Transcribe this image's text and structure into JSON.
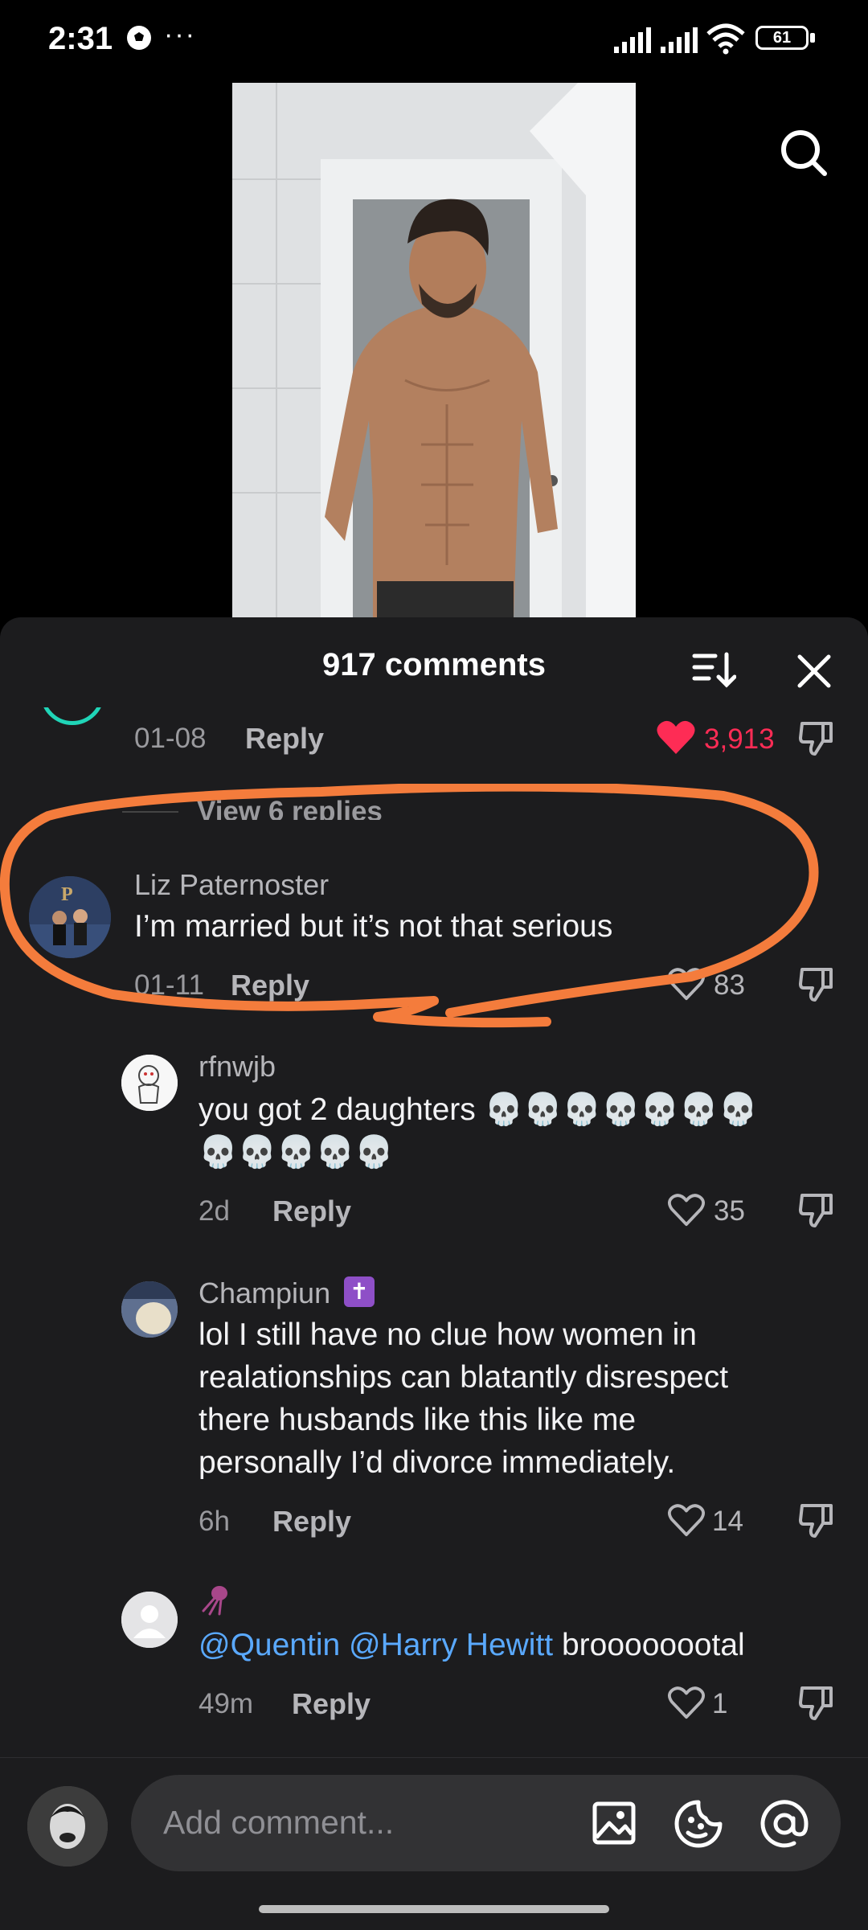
{
  "status_bar": {
    "time": "2:31",
    "overflow": "···",
    "battery": "61"
  },
  "sheet": {
    "title": "917 comments"
  },
  "top_comment": {
    "date": "01-08",
    "reply": "Reply",
    "likes": "3,913",
    "view_replies": "View 6 replies"
  },
  "comments": [
    {
      "name": "Liz Paternoster",
      "text": "I’m married but it’s not that serious",
      "date": "01-11",
      "reply": "Reply",
      "likes": "83"
    },
    {
      "name": "rfnwjb",
      "text_line1": "you got 2 daughters 💀💀💀💀💀💀💀",
      "text_line2": "💀💀💀💀💀",
      "date": "2d",
      "reply": "Reply",
      "likes": "35"
    },
    {
      "name": "Champiun",
      "name_badge": "✝",
      "text_lines": [
        "lol I still have no clue how women in",
        "realationships can blatantly disrespect",
        "there husbands like this like me",
        "personally I’d divorce immediately."
      ],
      "date": "6h",
      "reply": "Reply",
      "likes": "14"
    },
    {
      "mention1": "@Quentin",
      "mention2": "@Harry Hewitt",
      "text": "broooooootal",
      "date": "49m",
      "reply": "Reply",
      "likes": "1"
    }
  ],
  "composer": {
    "placeholder": "Add comment..."
  },
  "colors": {
    "accent_red": "#fe2c55",
    "mention_blue": "#5aa9ff",
    "highlight": "#f47c3c",
    "sheet_bg": "#1c1c1e"
  },
  "icons": [
    "soccer-icon",
    "signal-icon",
    "wifi-icon",
    "battery-icon",
    "search-icon",
    "sort-icon",
    "close-icon",
    "heart-icon",
    "dislike-icon",
    "image-icon",
    "emoji-icon",
    "mention-icon"
  ]
}
